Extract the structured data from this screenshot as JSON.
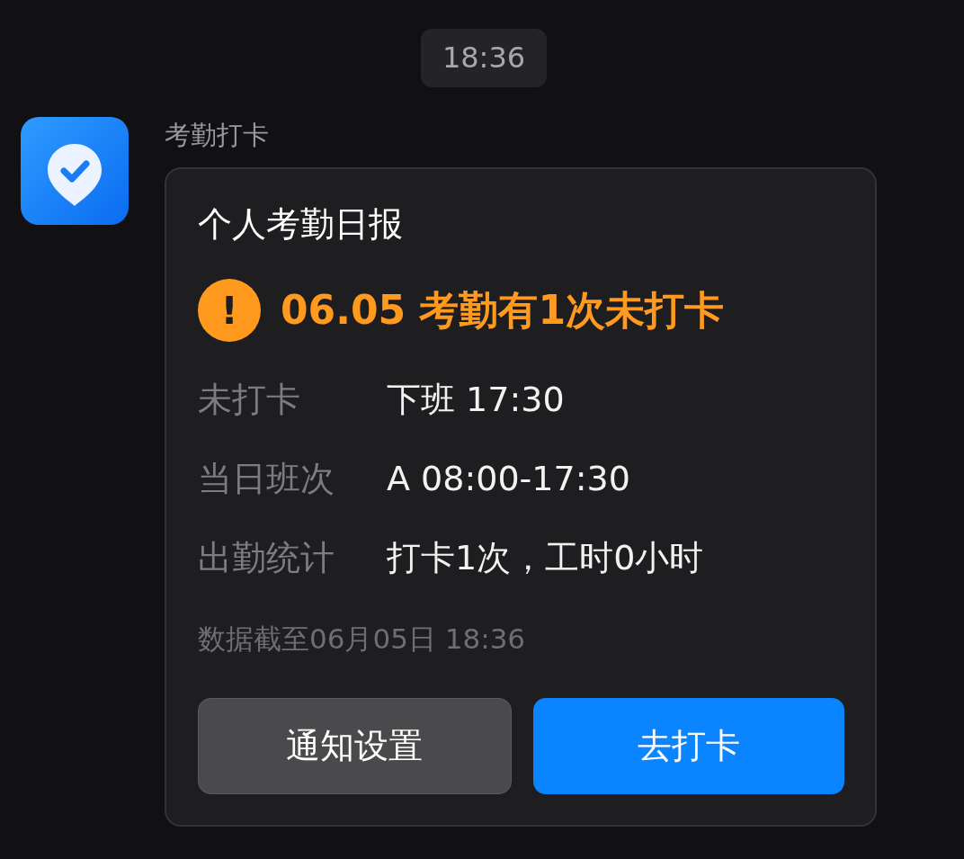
{
  "time_divider": "18:36",
  "message": {
    "sender": "考勤打卡",
    "card": {
      "title": "个人考勤日报",
      "alert": {
        "icon": "!",
        "text": "06.05 考勤有1次未打卡"
      },
      "rows": [
        {
          "label": "未打卡",
          "value": "下班 17:30"
        },
        {
          "label": "当日班次",
          "value": "A 08:00-17:30"
        },
        {
          "label": "出勤统计",
          "value": "打卡1次，工时0小时"
        }
      ],
      "footnote": "数据截至06月05日 18:36",
      "buttons": [
        {
          "label": "通知设置",
          "kind": "secondary"
        },
        {
          "label": "去打卡",
          "kind": "primary"
        }
      ]
    }
  }
}
